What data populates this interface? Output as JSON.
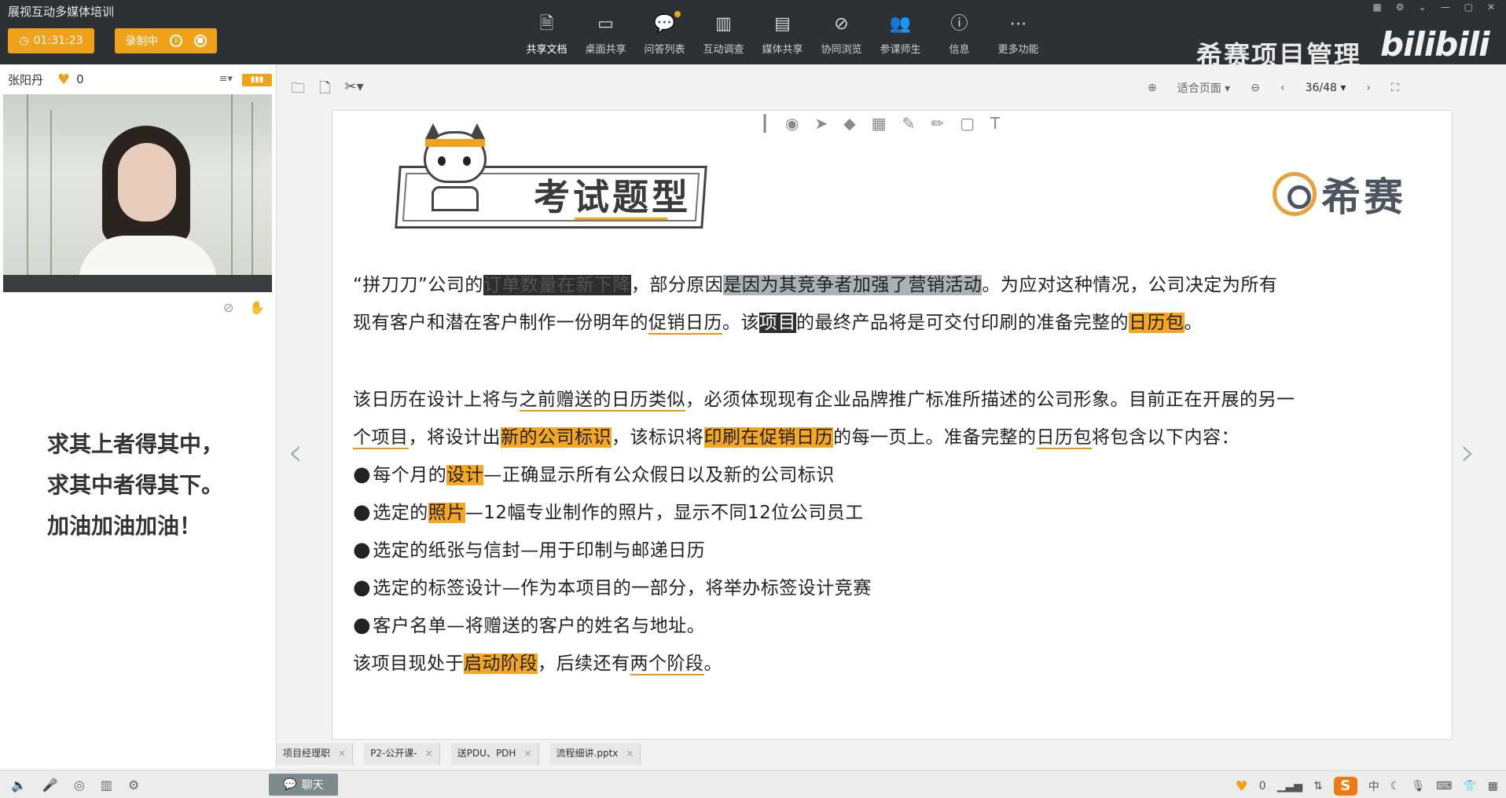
{
  "app": {
    "title": "展视互动多媒体培训"
  },
  "header": {
    "timer": "01:31:23",
    "recording_label": "录制中",
    "brand_text": "希赛项目管理",
    "bili_text": "bilibili"
  },
  "toolbar": {
    "items": [
      {
        "label": "共享文档",
        "icon": "doc-share-icon"
      },
      {
        "label": "桌面共享",
        "icon": "desktop-share-icon"
      },
      {
        "label": "问答列表",
        "icon": "qa-list-icon"
      },
      {
        "label": "互动调查",
        "icon": "survey-icon"
      },
      {
        "label": "媒体共享",
        "icon": "media-share-icon"
      },
      {
        "label": "协同浏览",
        "icon": "co-browse-icon"
      },
      {
        "label": "参课师生",
        "icon": "attendees-icon"
      },
      {
        "label": "信息",
        "icon": "info-icon"
      },
      {
        "label": "更多功能",
        "icon": "more-icon"
      }
    ]
  },
  "presenter": {
    "name": "张阳丹",
    "likes": "0"
  },
  "motto": {
    "line1": "求其上者得其中，",
    "line2": "求其中者得其下。",
    "line3": "加油加油加油！"
  },
  "doc_toolbar": {
    "zoom_label": "适合页面",
    "page_indicator": "36/48"
  },
  "slide": {
    "title": "考试题型",
    "logo_text": "希赛",
    "p1_a": "“拼刀刀”公司的",
    "p1_dark": "订单数量在新下降",
    "p1_b": "，部分原因",
    "p1_gray": "是因为其竞争者加强了营销活动",
    "p1_c": "。为应对这种情况，公司决定为所有",
    "p2_a": "现有客户和潜在客户制作一份明年的",
    "p2_u1": "促销日历",
    "p2_b": "。该",
    "p2_dark": "项目",
    "p2_c": "的最终产品将是可交付印刷的准备完整的",
    "p2_hl": "日历包",
    "p2_d": "。",
    "p3_a": "该日历在设计上将与",
    "p3_u": "之前赠送的日历类似",
    "p3_b": "，必须体现现有企业品牌推广标准所描述的公司形象。目前正在开展的另一",
    "p4_a": "个项目",
    "p4_b": "，将设计出",
    "p4_hl1": "新的公司标识",
    "p4_c": "，该标识将",
    "p4_hl2": "印刷在促销日历",
    "p4_d": "的每一页上。准备完整的",
    "p4_u": "日历包",
    "p4_e": "将包含以下内容：",
    "b1_a": "每个月的",
    "b1_hl": "设计",
    "b1_b": "—正确显示所有公众假日以及新的公司标识",
    "b2_a": "选定的",
    "b2_hl": "照片",
    "b2_b": "—12幅专业制作的照片，显示不同12位公司员工",
    "b3": "选定的纸张与信封—用于印制与邮递日历",
    "b4": "选定的标签设计—作为本项目的一部分，将举办标签设计竞赛",
    "b5": "客户名单—将赠送的客户的姓名与地址。",
    "p5_a": "该项目现处于",
    "p5_hl": "启动阶段",
    "p5_b": "，后续还有",
    "p5_u": "两个阶段",
    "p5_c": "。"
  },
  "tabs": [
    {
      "label": "项目经理职"
    },
    {
      "label": "P2-公开课-"
    },
    {
      "label": "送PDU、PDH"
    },
    {
      "label": "流程细讲.pptx"
    }
  ],
  "statusbar": {
    "chat_label": "聊天",
    "likes": "0",
    "ime_label": "中"
  },
  "colors": {
    "accent": "#f0a21a",
    "topbar": "#2e3133"
  }
}
